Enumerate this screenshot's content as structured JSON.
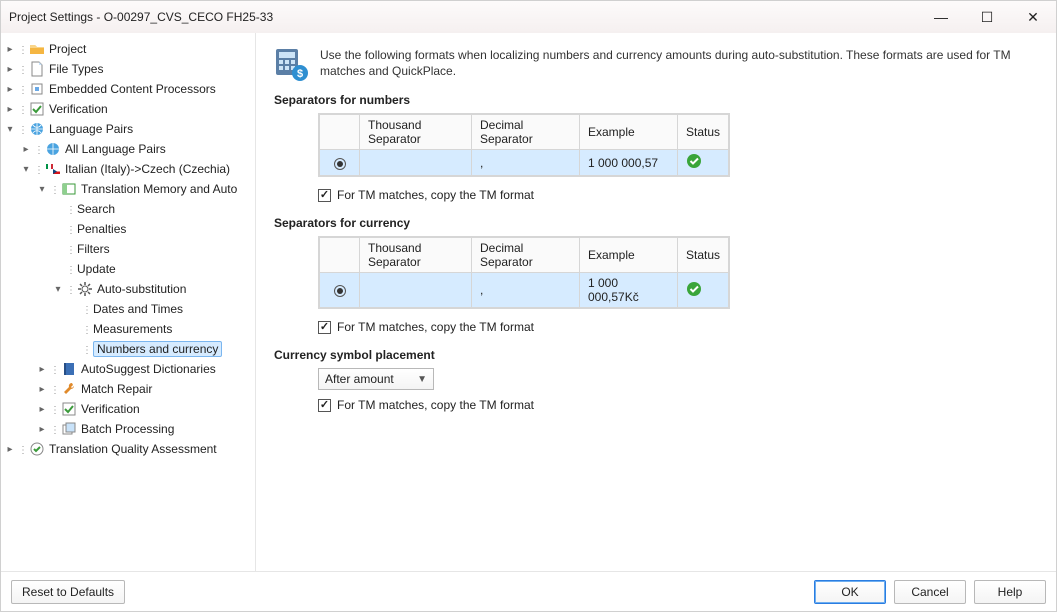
{
  "window": {
    "title": "Project Settings - O-00297_CVS_CECO FH25-33"
  },
  "tree": {
    "project": "Project",
    "fileTypes": "File Types",
    "embedded": "Embedded Content Processors",
    "verification": "Verification",
    "languagePairs": "Language Pairs",
    "allLangPairs": "All Language Pairs",
    "pair": "Italian (Italy)->Czech (Czechia)",
    "tm": "Translation Memory and Auto",
    "search": "Search",
    "penalties": "Penalties",
    "filters": "Filters",
    "update": "Update",
    "autoSub": "Auto-substitution",
    "dates": "Dates and Times",
    "measurements": "Measurements",
    "numbers": "Numbers and currency",
    "autosuggest": "AutoSuggest Dictionaries",
    "matchRepair": "Match Repair",
    "verification2": "Verification",
    "batch": "Batch Processing",
    "tqa": "Translation Quality Assessment"
  },
  "intro": "Use the following formats when localizing numbers and currency amounts during auto-substitution. These formats are used for TM matches and QuickPlace.",
  "sections": {
    "numbers": "Separators for numbers",
    "currency": "Separators for currency",
    "symbol": "Currency symbol placement"
  },
  "headers": {
    "thou": "Thousand Separator",
    "dec": "Decimal Separator",
    "ex": "Example",
    "st": "Status"
  },
  "numRow": {
    "thou": "",
    "dec": ",",
    "ex": "1 000 000,57"
  },
  "curRow": {
    "thou": "",
    "dec": ",",
    "ex": "1 000 000,57Kč"
  },
  "chk": "For TM matches, copy the TM format",
  "dropdown": {
    "value": "After amount"
  },
  "buttons": {
    "reset": "Reset to Defaults",
    "ok": "OK",
    "cancel": "Cancel",
    "help": "Help"
  }
}
